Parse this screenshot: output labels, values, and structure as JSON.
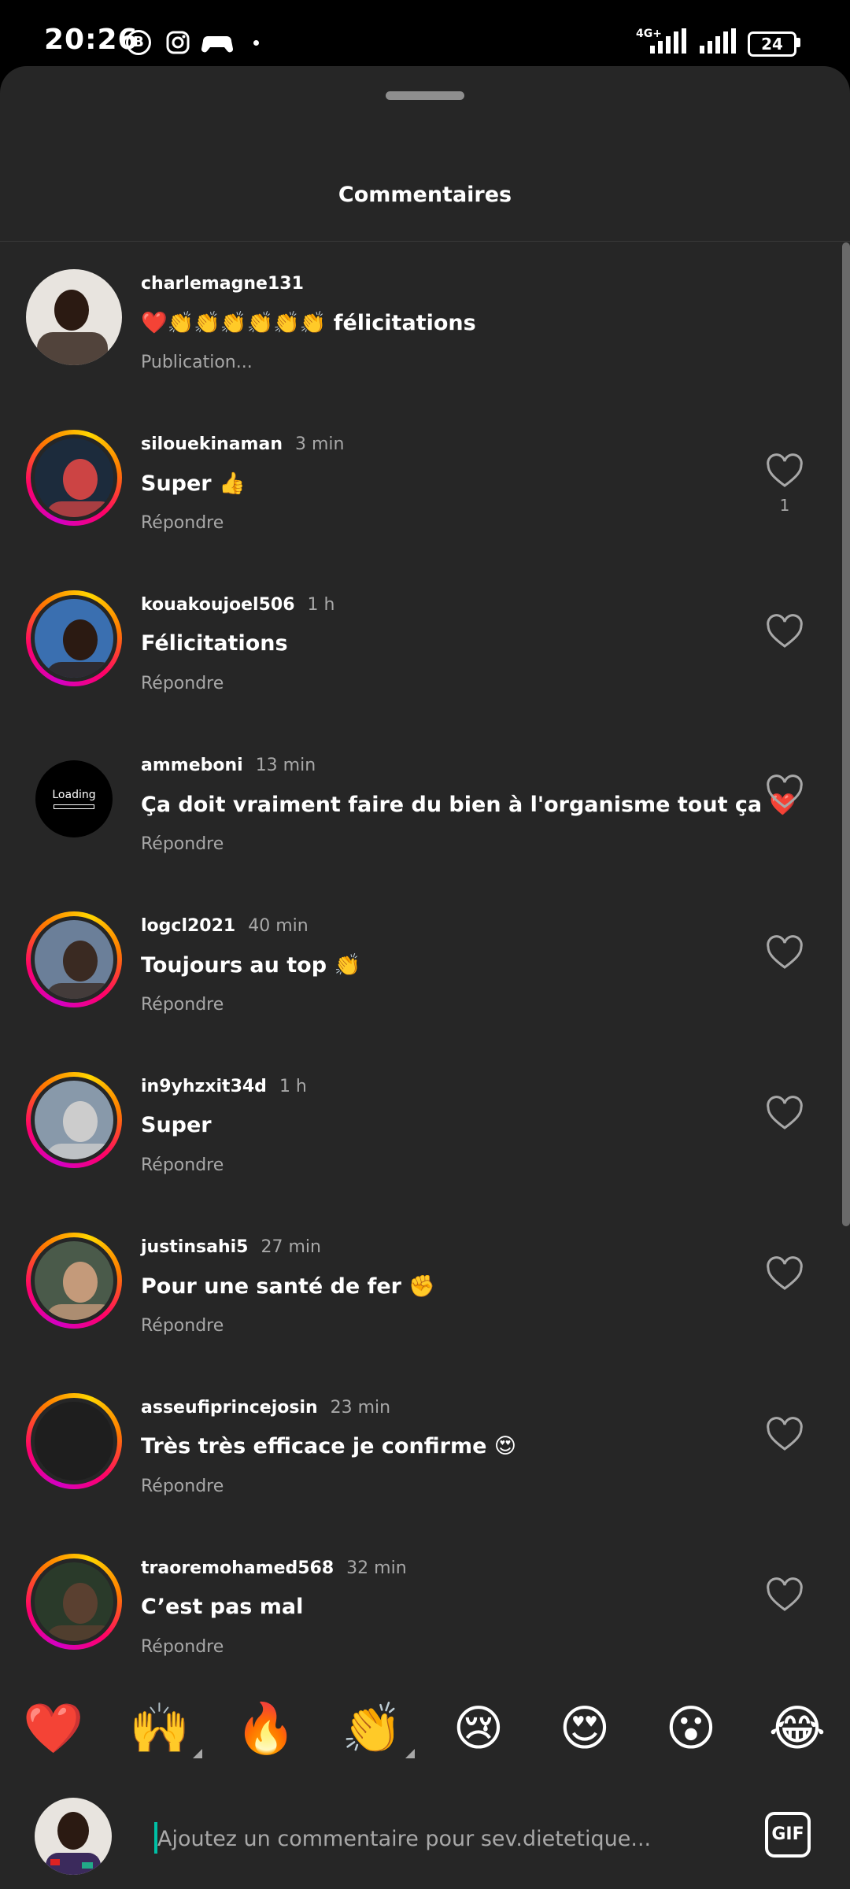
{
  "status_bar": {
    "time": "20:26",
    "b_badge": "B",
    "network": "4G+",
    "battery": "24"
  },
  "sheet": {
    "title": "Commentaires"
  },
  "comments": [
    {
      "username": "charlemagne131",
      "time": "",
      "text": "❤️👏👏👏👏👏👏 félicitations",
      "action": "Publication...",
      "likes": "",
      "avatar": "photo",
      "ring": false
    },
    {
      "username": "silouekinaman",
      "time": "3 min",
      "text": "Super 👍",
      "action": "Répondre",
      "likes": "1",
      "avatar": "photo",
      "ring": true
    },
    {
      "username": "kouakoujoel506",
      "time": "1 h",
      "text": "Félicitations",
      "action": "Répondre",
      "likes": "",
      "avatar": "photo",
      "ring": true
    },
    {
      "username": "ammeboni",
      "time": "13 min",
      "text": "Ça doit vraiment faire du bien à l'organisme tout ça ❤️",
      "action": "Répondre",
      "likes": "",
      "avatar": "loading",
      "ring": false
    },
    {
      "username": "logcl2021",
      "time": "40 min",
      "text": "Toujours au top 👏",
      "action": "Répondre",
      "likes": "",
      "avatar": "photo",
      "ring": true
    },
    {
      "username": "in9yhzxit34d",
      "time": "1 h",
      "text": "Super",
      "action": "Répondre",
      "likes": "",
      "avatar": "photo",
      "ring": true
    },
    {
      "username": "justinsahi5",
      "time": "27 min",
      "text": "Pour une santé de fer ✊",
      "action": "Répondre",
      "likes": "",
      "avatar": "photo",
      "ring": true
    },
    {
      "username": "asseufiprincejosin",
      "time": "23 min",
      "text": "Très très efficace je confirme 😍",
      "action": "Répondre",
      "likes": "",
      "avatar": "dark",
      "ring": true
    },
    {
      "username": "traoremohamed568",
      "time": "32 min",
      "text": "C’est pas mal",
      "action": "Répondre",
      "likes": "",
      "avatar": "photo",
      "ring": true
    }
  ],
  "loading_label": "Loading",
  "emoji_bar": [
    "❤️",
    "🙌",
    "🔥",
    "👏",
    "😢",
    "😍",
    "😮",
    "😂"
  ],
  "input": {
    "placeholder": "Ajoutez un commentaire pour sev.dietetique...",
    "gif_label": "GIF"
  },
  "colors": {
    "background": "#262626",
    "secondary_text": "#a8a8a8",
    "story_ring_start": "#d300c5",
    "story_ring_end": "#ff7a00"
  }
}
